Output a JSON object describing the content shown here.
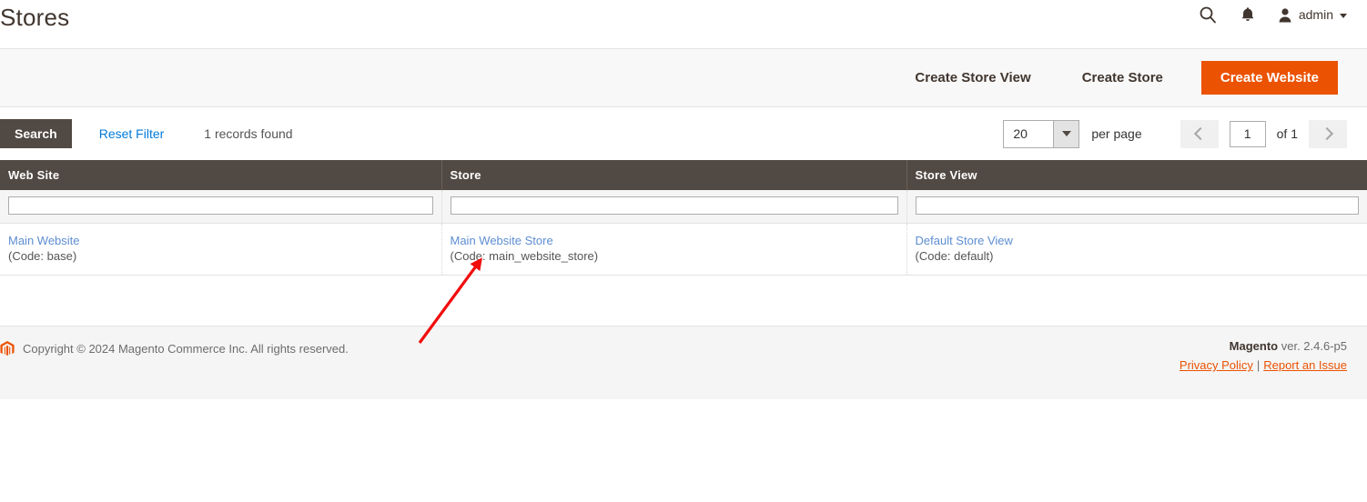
{
  "header": {
    "title": "Stores",
    "search_icon": "search-icon",
    "notifications_icon": "bell-icon",
    "avatar_icon": "user-avatar-icon",
    "admin_label": "admin",
    "caret_icon": "chevron-down-icon"
  },
  "page_actions": {
    "create_store_view": "Create Store View",
    "create_store": "Create Store",
    "create_website": "Create Website",
    "primary_color": "#eb5202"
  },
  "toolbar": {
    "search_button": "Search",
    "reset_filter": "Reset Filter",
    "records_found": "1 records found",
    "per_page_value": "20",
    "per_page_label": "per page",
    "prev_icon": "chevron-left-icon",
    "next_icon": "chevron-right-icon",
    "current_page": "1",
    "of_label": "of 1"
  },
  "grid": {
    "columns": [
      {
        "label": "Web Site",
        "filter_value": ""
      },
      {
        "label": "Store",
        "filter_value": ""
      },
      {
        "label": "Store View",
        "filter_value": ""
      }
    ],
    "rows": [
      {
        "website_name": "Main Website",
        "website_code": "(Code: base)",
        "store_name": "Main Website Store",
        "store_code": "(Code: main_website_store)",
        "store_view_name": "Default Store View",
        "store_view_code": "(Code: default)"
      }
    ],
    "header_bg": "#514943",
    "link_color": "#5e8ed2"
  },
  "footer": {
    "logo_icon": "magento-logo-icon",
    "copyright": "Copyright © 2024 Magento Commerce Inc. All rights reserved.",
    "brand": "Magento",
    "version": " ver. 2.4.6-p5",
    "privacy_policy": "Privacy Policy",
    "separator": "|",
    "report_issue": "Report an Issue"
  },
  "annotation": {
    "arrow_color": "#f20d0d",
    "name": "red-arrow-annotation"
  }
}
